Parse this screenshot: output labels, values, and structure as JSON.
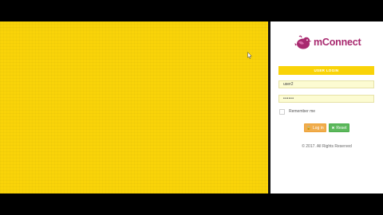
{
  "brand": {
    "name": "mConnect",
    "icon": "bird-logo-icon",
    "color": "#a8296f"
  },
  "login": {
    "header": "USER LOGIN",
    "username_value": "user2",
    "password_value": "••••••",
    "remember_label": "Remember me",
    "login_button_label": "Log in",
    "login_button_icon": "lock-icon",
    "reset_button_label": "Reset",
    "reset_button_icon": "close-icon",
    "copyright": "© 2017. All Rights Reserved"
  },
  "colors": {
    "accent_yellow": "#f9d309",
    "login_button": "#f0ad4e",
    "reset_button": "#5cb85c",
    "input_bg": "#fcfbd2"
  }
}
